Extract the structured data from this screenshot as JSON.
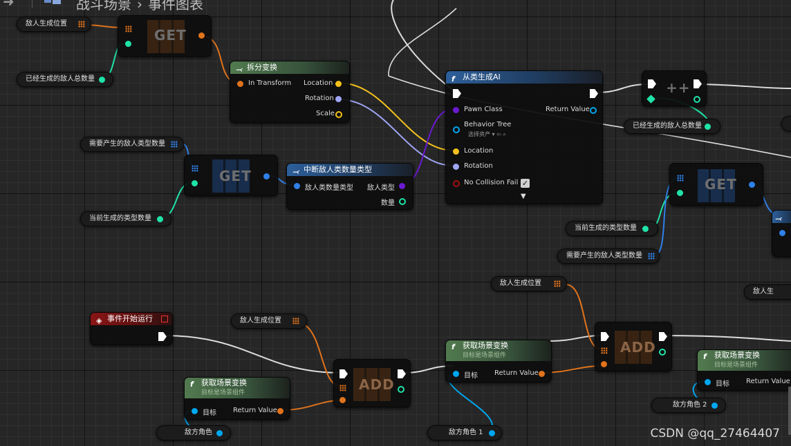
{
  "breadcrumb": {
    "item1": "战斗场景",
    "separator": "›",
    "item2": "事件图表"
  },
  "colors": {
    "exec": "#ffffff",
    "vector": "#f5c21b",
    "rotator": "#9fa6f5",
    "int": "#1fe3a8",
    "object": "#00a7f0",
    "class": "#6a1ad1",
    "struct": "#0a5ad4"
  },
  "vars": {
    "spawn_pos": "敌人生成位置",
    "spawned_total": "已经生成的敌人总数量",
    "need_types_count": "需要产生的敌人类型数量",
    "current_type_count": "当前生成的类型数量",
    "enemy_char": "敌方角色",
    "enemy_char1": "敌方角色 1",
    "enemy_char2": "敌方角色 2",
    "enemy_gen_cut": "敌人生"
  },
  "nodes": {
    "get": "GET",
    "add": "ADD",
    "increment": "++",
    "break_transform": {
      "title": "拆分变换",
      "in": "In Transform",
      "location": "Location",
      "rotation": "Rotation",
      "scale": "Scale"
    },
    "spawn_ai": {
      "title": "从类生成AI",
      "pawn_class": "Pawn Class",
      "return_value": "Return Value",
      "behavior_tree": "Behavior Tree",
      "select_asset": "选择资产",
      "location": "Location",
      "rotation": "Rotation",
      "no_collision": "No Collision Fail"
    },
    "break_struct": {
      "title": "中断敌人类数量类型",
      "in": "敌人类数量类型",
      "out_type": "敌人类型",
      "out_count": "数量"
    },
    "begin_play": {
      "title": "事件开始运行"
    },
    "get_world_transform": {
      "title": "获取场景变换",
      "subtitle": "目标是场景组件",
      "target": "目标",
      "return_value": "Return Value"
    }
  },
  "watermark": "CSDN @qq_27464407"
}
